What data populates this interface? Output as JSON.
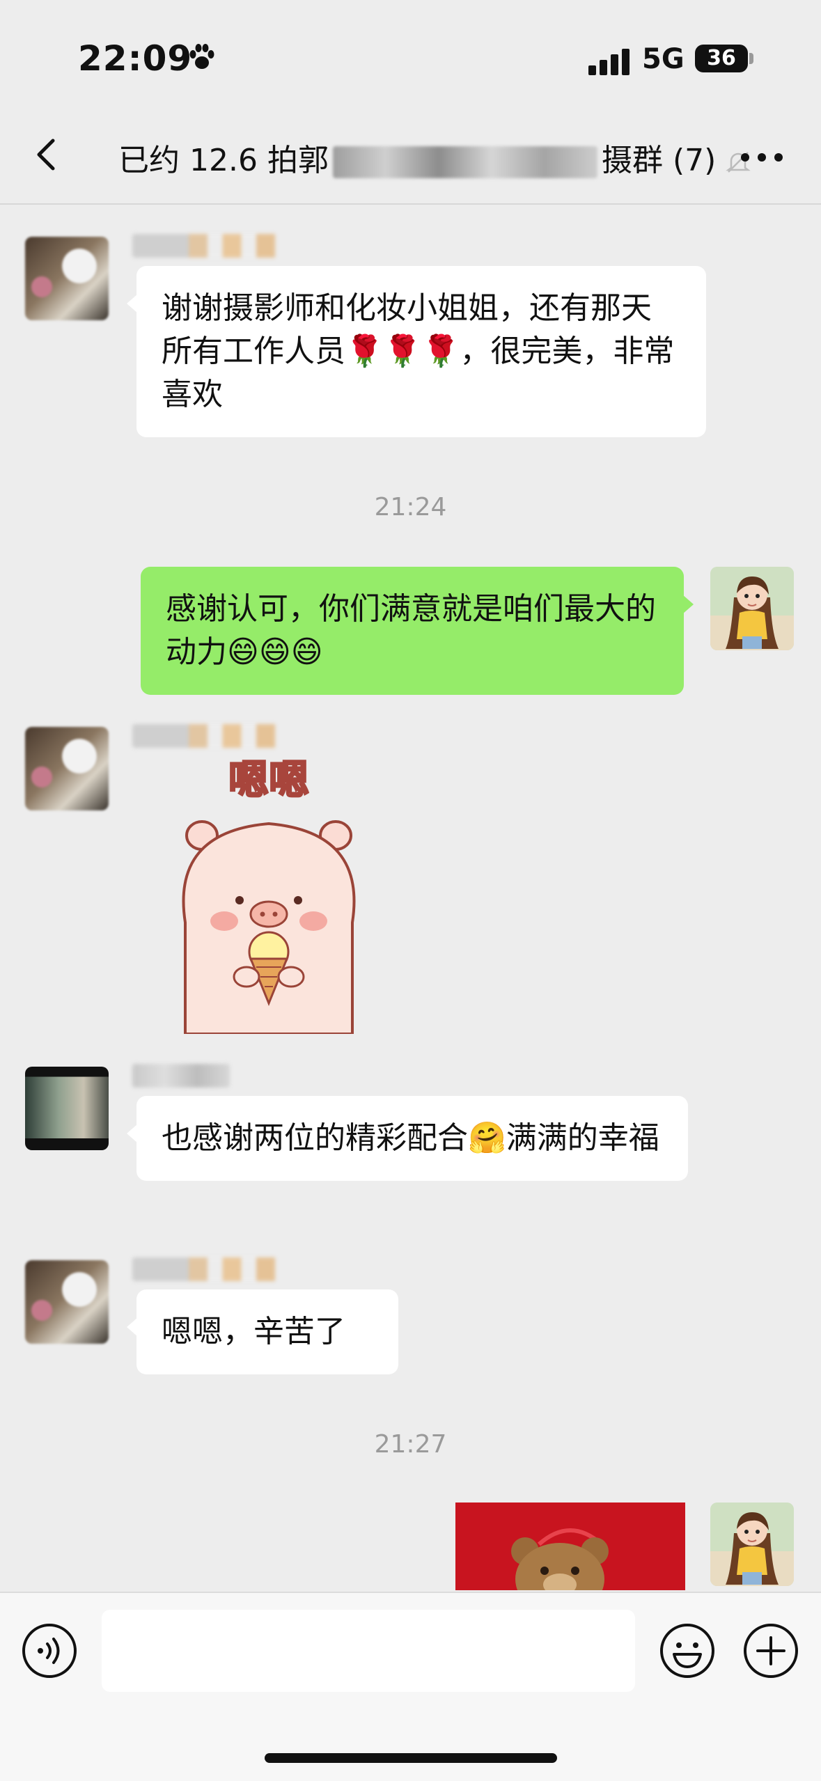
{
  "status_bar": {
    "time": "22:09",
    "network": "5G",
    "battery": "36"
  },
  "header": {
    "title_start": "已约 12.6 拍郭",
    "title_end": "摄群 (7)",
    "back_icon": "chevron-left-icon",
    "mute_icon": "bell-slash-icon",
    "more_icon": "more-horizontal-icon"
  },
  "messages": [
    {
      "side": "left",
      "text": "谢谢摄影师和化妆小姐姐，还有那天所有工作人员🌹🌹🌹，很完美，非常喜欢"
    },
    {
      "type": "time",
      "text": "21:24"
    },
    {
      "side": "right",
      "text": "感谢认可，你们满意就是咱们最大的动力😄😄😄"
    },
    {
      "side": "left",
      "type": "sticker",
      "sticker_text": "嗯嗯"
    },
    {
      "side": "left",
      "text": "也感谢两位的精彩配合🤗满满的幸福"
    },
    {
      "side": "left",
      "text": "嗯嗯，辛苦了"
    },
    {
      "type": "time",
      "text": "21:27"
    },
    {
      "side": "right",
      "type": "image"
    }
  ],
  "input_bar": {
    "placeholder": "",
    "voice_icon": "voice-icon",
    "emoji_icon": "emoji-icon",
    "plus_icon": "plus-circle-icon"
  },
  "colors": {
    "background": "#ededed",
    "bubble_self": "#95ec69",
    "bubble_other": "#ffffff"
  }
}
